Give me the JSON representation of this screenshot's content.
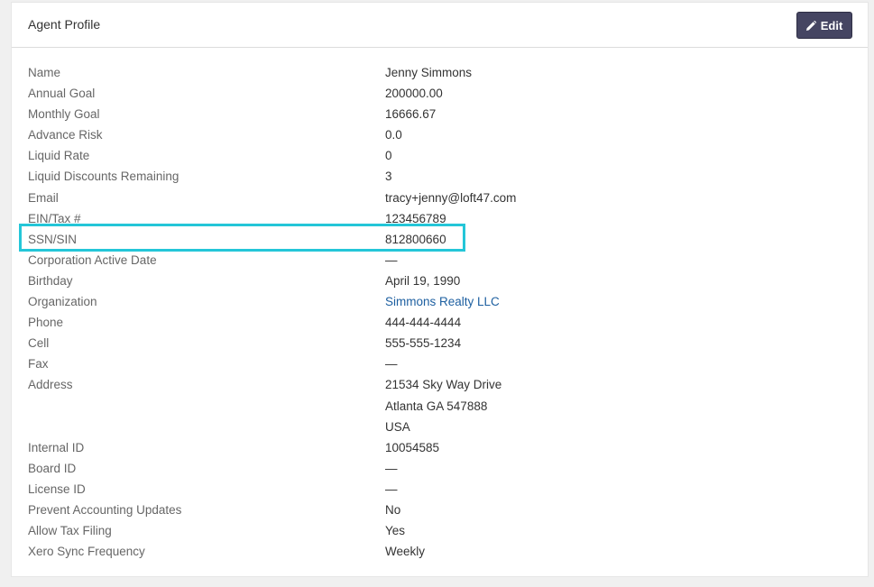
{
  "panel": {
    "title": "Agent Profile",
    "edit_label": "Edit"
  },
  "rows": [
    {
      "label": "Name",
      "value": "Jenny Simmons"
    },
    {
      "label": "Annual Goal",
      "value": "200000.00"
    },
    {
      "label": "Monthly Goal",
      "value": "16666.67"
    },
    {
      "label": "Advance Risk",
      "value": "0.0"
    },
    {
      "label": "Liquid Rate",
      "value": "0"
    },
    {
      "label": "Liquid Discounts Remaining",
      "value": "3"
    },
    {
      "label": "Email",
      "value": "tracy+jenny@loft47.com"
    },
    {
      "label": "EIN/Tax #",
      "value": "123456789"
    },
    {
      "label": "SSN/SIN",
      "value": "812800660"
    },
    {
      "label": "Corporation Active Date",
      "value": "—"
    },
    {
      "label": "Birthday",
      "value": "April 19, 1990"
    },
    {
      "label": "Organization",
      "value": "Simmons Realty LLC"
    },
    {
      "label": "Phone",
      "value": "444-444-4444"
    },
    {
      "label": "Cell",
      "value": "555-555-1234"
    },
    {
      "label": "Fax",
      "value": "—"
    },
    {
      "label": "Address",
      "value": "21534 Sky Way Drive"
    },
    {
      "label": "",
      "value": "Atlanta GA 547888"
    },
    {
      "label": "",
      "value": "USA"
    },
    {
      "label": "Internal ID",
      "value": "10054585"
    },
    {
      "label": "Board ID",
      "value": "—"
    },
    {
      "label": "License ID",
      "value": "—"
    },
    {
      "label": "Prevent Accounting Updates",
      "value": "No"
    },
    {
      "label": "Allow Tax Filing",
      "value": "Yes"
    },
    {
      "label": "Xero Sync Frequency",
      "value": "Weekly"
    }
  ],
  "colors": {
    "edit_button_bg": "#454562",
    "link": "#1d5fa0",
    "highlight": "#24c6d8"
  },
  "icons": {
    "edit": "pencil-icon"
  }
}
